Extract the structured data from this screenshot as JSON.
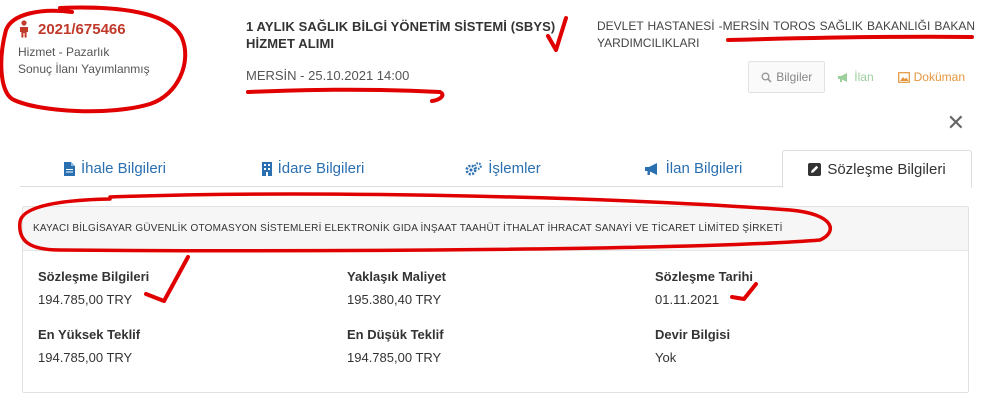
{
  "header": {
    "tender_no": "2021/675466",
    "type": "Hizmet - Pazarlık",
    "status": "Sonuç İlanı Yayımlanmış",
    "title": "1 AYLIK SAĞLIK BİLGİ YÖNETİM SİSTEMİ (SBYS) HİZMET ALIMI",
    "location_date": "MERSİN - 25.10.2021 14:00",
    "organization": "DEVLET HASTANESİ -MERSİN TOROS SAĞLIK BAKANLIĞI BAKAN YARDIMCILIKLARI"
  },
  "buttons": {
    "bilgiler": "Bilgiler",
    "ilan": "İlan",
    "dokuman": "Doküman"
  },
  "tabs": [
    {
      "label": "İhale Bilgileri"
    },
    {
      "label": "İdare Bilgileri"
    },
    {
      "label": "İşlemler"
    },
    {
      "label": "İlan Bilgileri"
    },
    {
      "label": "Sözleşme Bilgileri"
    }
  ],
  "panel": {
    "company": "KAYACI BİLGİSAYAR GÜVENLİK OTOMASYON SİSTEMLERİ ELEKTRONİK GIDA İNŞAAT TAAHÜT İTHALAT İHRACAT SANAYİ VE TİCARET LİMİTED ŞİRKETİ",
    "fields": [
      {
        "label": "Sözleşme Bilgileri",
        "value": "194.785,00 TRY"
      },
      {
        "label": "Yaklaşık Maliyet",
        "value": "195.380,40 TRY"
      },
      {
        "label": "Sözleşme Tarihi",
        "value": "01.11.2021"
      },
      {
        "label": "En Yüksek Teklif",
        "value": "194.785,00 TRY"
      },
      {
        "label": "En Düşük Teklif",
        "value": "194.785,00 TRY"
      },
      {
        "label": "Devir Bilgisi",
        "value": "Yok"
      }
    ]
  },
  "colors": {
    "accent": "#2a6fb0",
    "tender_red": "#c0392b",
    "annotation_red": "#e00000",
    "ilan_green": "#9ccf9c",
    "dokuman_orange": "#e3963e"
  }
}
